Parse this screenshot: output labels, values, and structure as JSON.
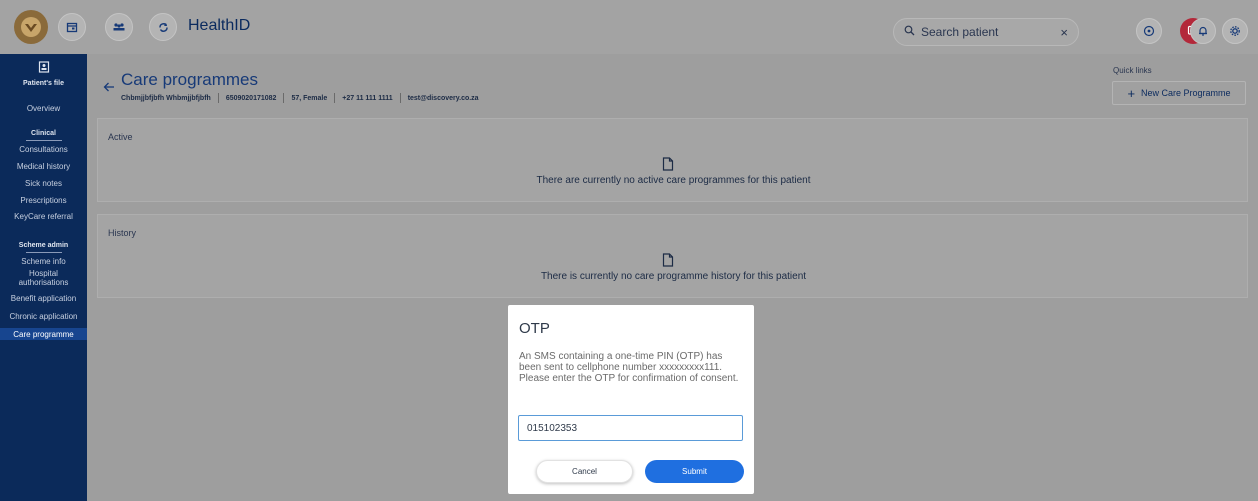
{
  "app": {
    "title": "HealthID"
  },
  "topbar": {
    "icons": [
      "logo-icon",
      "calendar-icon",
      "team-icon",
      "refresh-icon",
      "chat-icon",
      "help-icon",
      "notification-icon",
      "settings-icon"
    ],
    "search": {
      "placeholder": "Search patient",
      "clear": "×"
    }
  },
  "sidebar": {
    "header": "Patient's file",
    "items": {
      "overview": "Overview",
      "clinical": "Clinical",
      "consultations": "Consultations",
      "medical_history": "Medical history",
      "sick_notes": "Sick notes",
      "prescriptions": "Prescriptions",
      "keycare_referral": "KeyCare referral",
      "scheme_admin": "Scheme admin",
      "scheme_info": "Scheme info",
      "hospital_auth_1": "Hospital",
      "hospital_auth_2": "authorisations",
      "benefit_application": "Benefit application",
      "chronic_application": "Chronic application",
      "care_programme": "Care programme"
    },
    "active": "care_programme"
  },
  "page": {
    "title": "Care programmes",
    "patient": {
      "name": "Chbmjjbfjbfh Whbmjjbfjbfh",
      "id": "6509020171082",
      "age_gender": "57, Female",
      "phone": "+27 11 111 1111",
      "email": "test@discovery.co.za"
    },
    "quick_links": {
      "label": "Quick links",
      "new_button": "New Care Programme"
    },
    "active": {
      "label": "Active",
      "empty": "There are currently no active care programmes for this patient"
    },
    "history": {
      "label": "History",
      "empty": "There is currently no care programme history for this patient"
    }
  },
  "modal": {
    "title": "OTP",
    "body": "An SMS containing a one-time PIN (OTP) has been sent to cellphone number xxxxxxxxx111. Please enter the OTP for confirmation of consent.",
    "otp_value": "015102353",
    "cancel": "Cancel",
    "submit": "Submit"
  },
  "colors": {
    "sidebar": "#0b2a5a",
    "accent": "#1f6fe0",
    "alert": "#b3283a"
  }
}
